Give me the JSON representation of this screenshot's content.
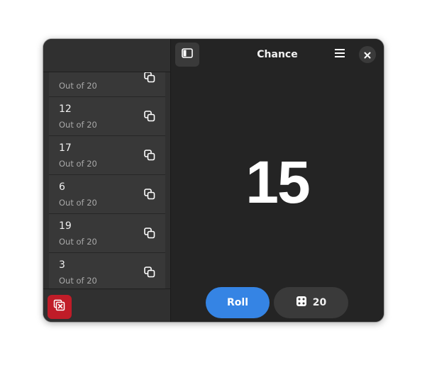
{
  "app": {
    "title": "Chance"
  },
  "history": {
    "items": [
      {
        "value": "",
        "subtitle": "Out of 20"
      },
      {
        "value": "12",
        "subtitle": "Out of 20"
      },
      {
        "value": "17",
        "subtitle": "Out of 20"
      },
      {
        "value": "6",
        "subtitle": "Out of 20"
      },
      {
        "value": "19",
        "subtitle": "Out of 20"
      },
      {
        "value": "3",
        "subtitle": "Out of 20"
      }
    ]
  },
  "result": {
    "value": "15"
  },
  "controls": {
    "roll_label": "Roll",
    "dice_sides": "20"
  },
  "icons": {
    "sidebar_toggle": "sidebar-show-icon",
    "menu": "hamburger-menu-icon",
    "close": "close-icon",
    "copy": "copy-icon",
    "clear": "clear-history-icon",
    "dice": "dice-icon"
  },
  "colors": {
    "accent": "#3584e4",
    "destructive": "#c01c28",
    "background": "#242424"
  }
}
